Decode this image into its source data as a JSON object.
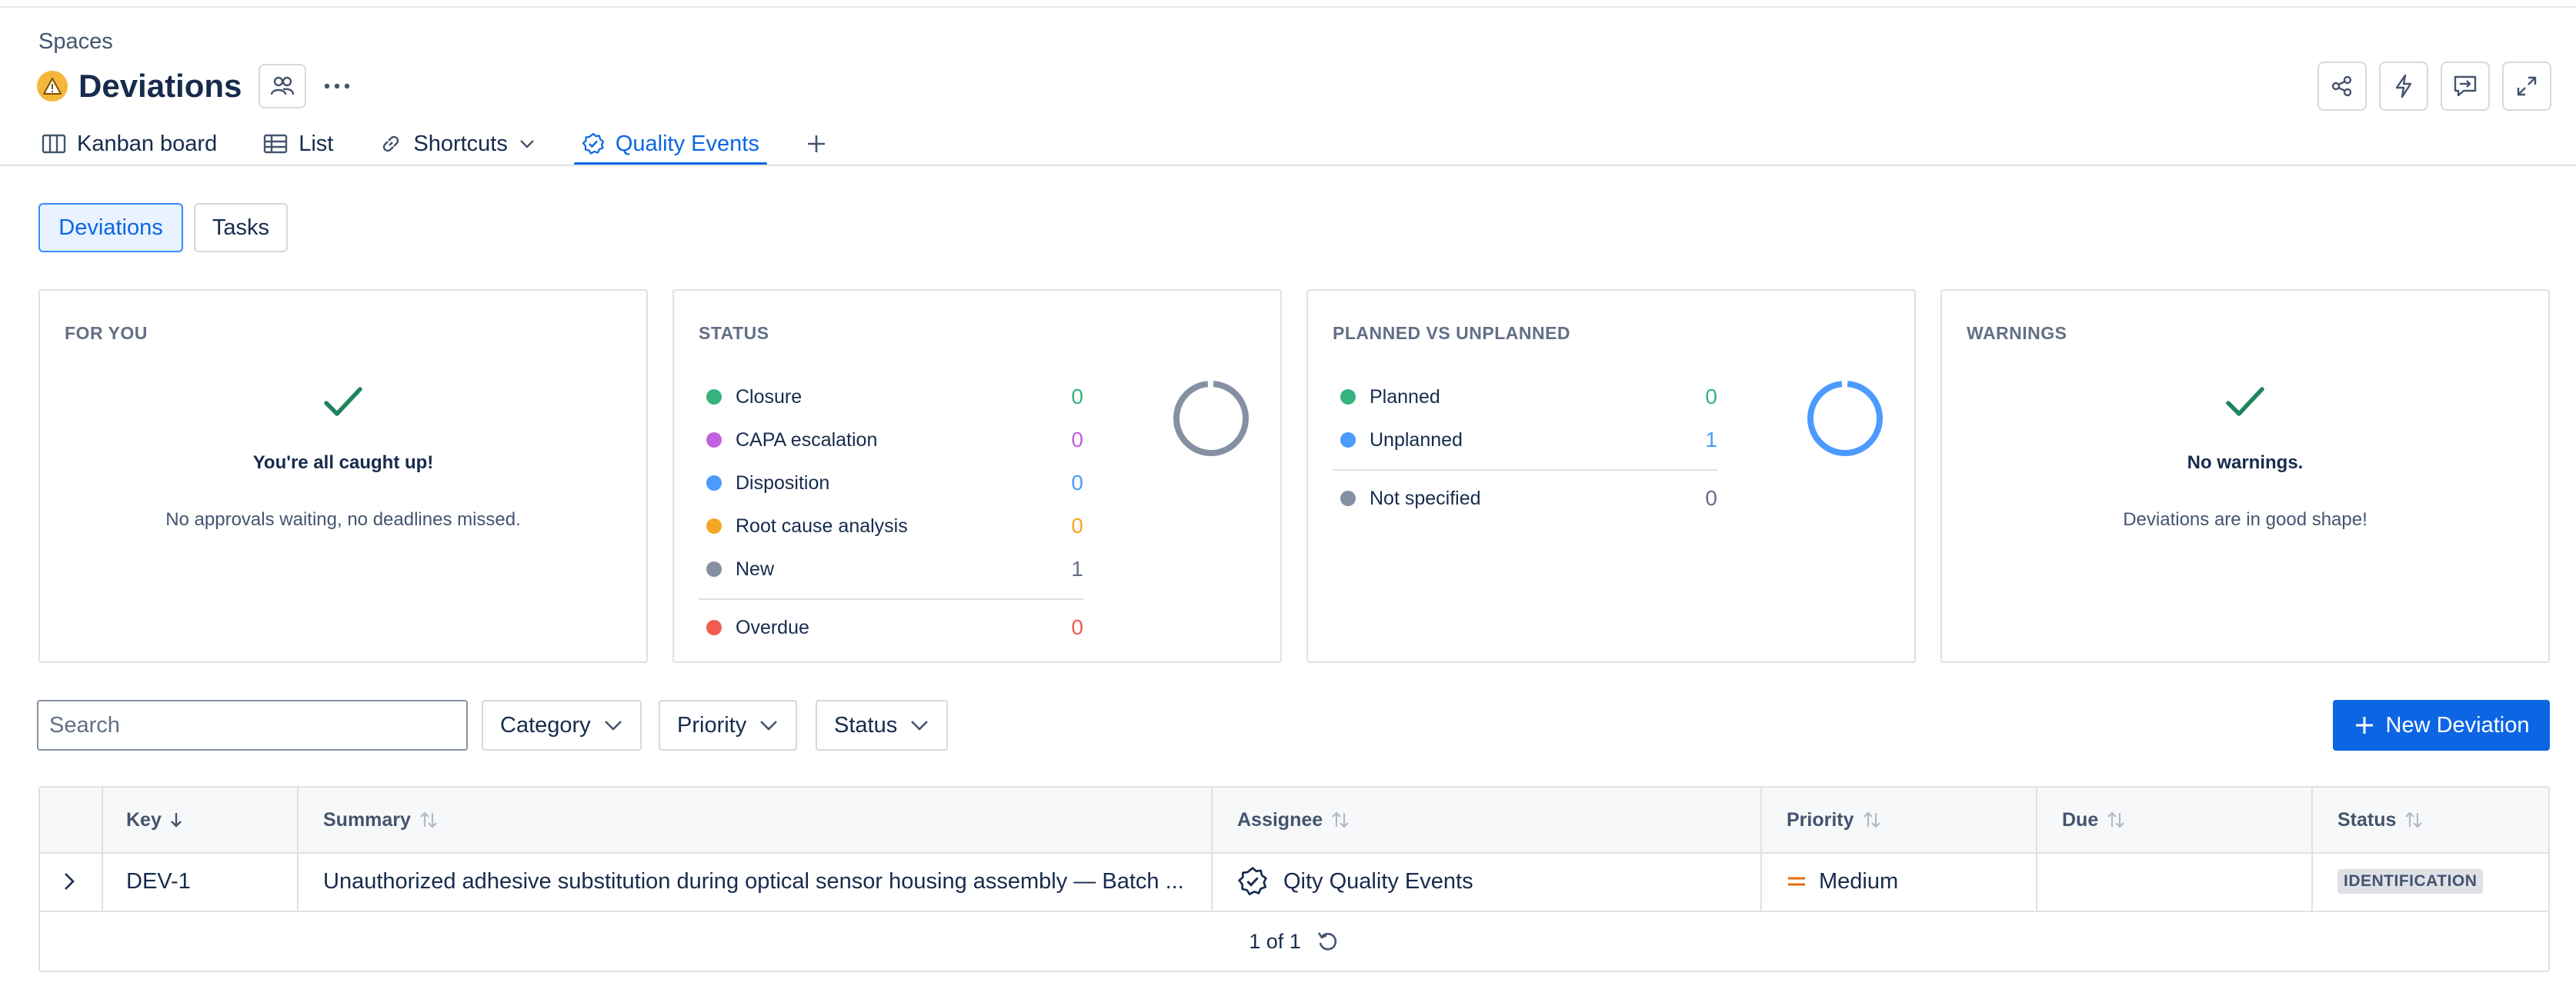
{
  "breadcrumb": "Spaces",
  "header": {
    "title": "Deviations"
  },
  "tabs": [
    {
      "label": "Kanban board",
      "icon": "board-icon"
    },
    {
      "label": "List",
      "icon": "list-icon"
    },
    {
      "label": "Shortcuts",
      "icon": "link-icon"
    },
    {
      "label": "Quality Events",
      "icon": "badge-check-icon",
      "active": true
    }
  ],
  "segments": {
    "selected": "Deviations",
    "other": "Tasks"
  },
  "cards": {
    "for_you": {
      "heading": "FOR YOU",
      "title": "You're all caught up!",
      "message": "No approvals waiting, no deadlines missed."
    },
    "status": {
      "heading": "STATUS",
      "items": [
        {
          "label": "Closure",
          "value": "0",
          "color": "#36b37e"
        },
        {
          "label": "CAPA escalation",
          "value": "0",
          "color": "#c061e0"
        },
        {
          "label": "Disposition",
          "value": "0",
          "color": "#4c9aff"
        },
        {
          "label": "Root cause analysis",
          "value": "0",
          "color": "#f5a623"
        },
        {
          "label": "New",
          "value": "1",
          "color": "#8590a2"
        }
      ],
      "overdue": {
        "label": "Overdue",
        "value": "0",
        "color": "#f15b50"
      }
    },
    "planned": {
      "heading": "PLANNED VS UNPLANNED",
      "items": [
        {
          "label": "Planned",
          "value": "0",
          "color": "#36b37e"
        },
        {
          "label": "Unplanned",
          "value": "1",
          "color": "#4c9aff"
        }
      ],
      "unspecified": {
        "label": "Not specified",
        "value": "0",
        "color": "#8590a2"
      }
    },
    "warnings": {
      "heading": "WARNINGS",
      "title": "No warnings.",
      "message": "Deviations are in good shape!"
    }
  },
  "filters": {
    "search_placeholder": "Search",
    "category": "Category",
    "priority": "Priority",
    "status": "Status"
  },
  "new_button": "New Deviation",
  "table": {
    "columns": {
      "key": "Key",
      "summary": "Summary",
      "assignee": "Assignee",
      "priority": "Priority",
      "due": "Due",
      "status": "Status"
    },
    "rows": [
      {
        "key": "DEV-1",
        "summary": "Unauthorized adhesive substitution during optical sensor housing assembly — Batch ...",
        "assignee": "Qity Quality Events",
        "priority": "Medium",
        "due": "",
        "status": "IDENTIFICATION"
      }
    ],
    "pagination": "1 of 1"
  },
  "colors": {
    "accent": "#0c66e4",
    "success": "#1f845a",
    "warning": "#f5b73b",
    "priority_medium": "#e56910"
  }
}
